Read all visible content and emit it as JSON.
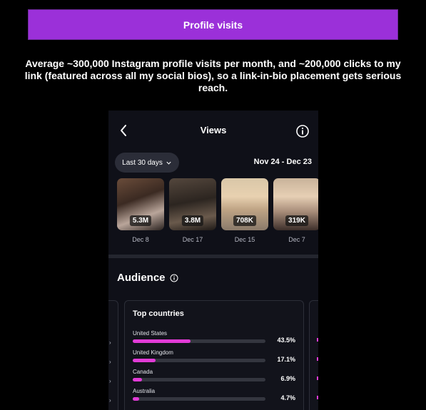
{
  "banner": {
    "title": "Profile visits"
  },
  "blurb": "Average ~300,000 Instagram profile visits per month, and ~200,000 clicks to my link (featured across all my social bios), so a link-in-bio placement gets serious reach.",
  "colors": {
    "banner": "#9b30d9",
    "bar_fill": "#e23bd7",
    "phone_bg": "#0f1018"
  },
  "views_screen": {
    "title": "Views",
    "range_label": "Last 30 days",
    "date_range": "Nov 24 - Dec 23",
    "posts": [
      {
        "views": "5.3M",
        "date": "Dec 8"
      },
      {
        "views": "3.8M",
        "date": "Dec 17"
      },
      {
        "views": "708K",
        "date": "Dec 15"
      },
      {
        "views": "319K",
        "date": "Dec 7"
      }
    ],
    "audience": {
      "title": "Audience",
      "card_title": "Top countries",
      "countries": [
        {
          "name": "United States",
          "percent": "43.5%",
          "value": 43.5
        },
        {
          "name": "United Kingdom",
          "percent": "17.1%",
          "value": 17.1
        },
        {
          "name": "Canada",
          "percent": "6.9%",
          "value": 6.9
        },
        {
          "name": "Australia",
          "percent": "4.7%",
          "value": 4.7
        }
      ]
    }
  }
}
